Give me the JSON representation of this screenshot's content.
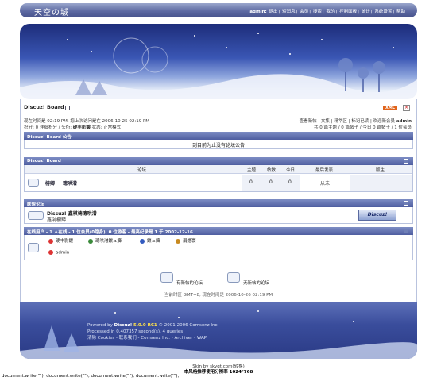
{
  "top": {
    "logo": "天空の城",
    "user_label": "admin:",
    "nav": [
      "退出",
      "短消息",
      "会员",
      "搜索",
      "我的",
      "控制面板",
      "统计",
      "系统设置",
      "帮助"
    ]
  },
  "board_title": "Discuz! Board",
  "xml_badge": "XML",
  "info": {
    "line1": "现在时间是 02:19 PM, 您上次访问是在 2006-10-25 02:19 PM",
    "line2_prefix": "积分: 0 详细积分 / 头衔:",
    "line2_title": "硬丰影鍍",
    "line2_suffix": "状态: 正常模式",
    "right1": "查看新帖 | 文集 | 精华区 | 标记已读 | 欢迎新会员",
    "right1_user": "admin",
    "right2": "共 0 篇主题 / 0 篇帖子 / 今日 0 篇帖子 / 1 位会员"
  },
  "announce": {
    "header": "Discuz! Board 公告",
    "text": "到目前为止没有论坛公告"
  },
  "forum": {
    "header": "Discuz! Board",
    "columns": [
      "论坛",
      "主题",
      "帖数",
      "今日",
      "最后发表",
      "版主"
    ],
    "row": {
      "name": "椿卿",
      "sub": "璁哄潧",
      "topics": "0",
      "posts": "0",
      "today": "0",
      "last": "从未",
      "mod": ""
    }
  },
  "links": {
    "header": "联盟论坛",
    "name": "Discuz! 鑫棋椅璁哄潧",
    "desc": "鑫涓樹鍗",
    "logo_text": "Discuz!"
  },
  "online": {
    "header_prefix": "在线用户 - ",
    "header_parts": [
      "1",
      "人在线 - ",
      "1",
      "位会员(",
      "0",
      "隐身), ",
      "0",
      "位游客 - 最高纪录是 ",
      "1",
      "于",
      "2002-12-16"
    ],
    "legend": [
      "硬丰影鍍",
      "璁哄潧鑲ュ簲",
      "鑲ュ簲",
      "涓熸寰"
    ],
    "legend_colors": [
      "#d33",
      "#3a8a3a",
      "#335bbf",
      "#c88a20"
    ],
    "users": [
      "admin"
    ]
  },
  "bottom_links": {
    "new": "有新帖的论坛",
    "nonew": "无新帖的论坛"
  },
  "timezone": "当前时区 GMT+8, 现在时间是 2006-10-26 02:19 PM",
  "copyright": {
    "powered": "Powered by",
    "brand": "Discuz!",
    "version": "5.0.0 RC1",
    "rights": "© 2001-2006 Comsenz Inc.",
    "processed": "Processed in 0.407357 second(s), 4 queries",
    "links": "清除 Cookies - 联系我们 - Comsenz Inc. - Archiver - WAP"
  },
  "skin_line": "Skin by skyqt.com(转换)",
  "resolution": "本风格推荐使用分辨率 1024*768",
  "script_line": "document.write(\"\"); document.write(\"\"); document.write(\"\"); document.write(\"\");"
}
